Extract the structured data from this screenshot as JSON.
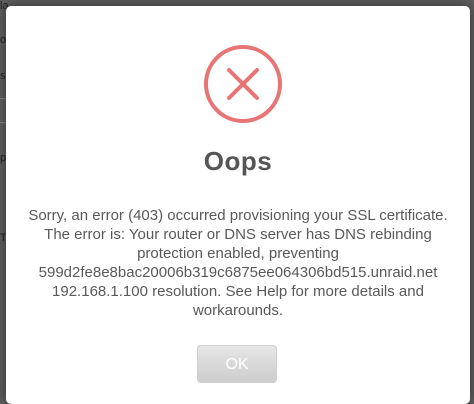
{
  "background": {
    "fragments": [
      "la",
      "o",
      "s",
      "p",
      "T"
    ]
  },
  "dialog": {
    "icon": "error-x-circle-icon",
    "title": "Oops",
    "message": "Sorry, an error (403) occurred provisioning your SSL certificate. The error is: Your router or DNS server has DNS rebinding protection enabled, preventing 599d2fe8e8bac20006b319c6875ee064306bd515.unraid.net 192.168.1.100 resolution. See Help for more details and workarounds.",
    "ok_label": "OK"
  },
  "colors": {
    "error_accent": "#e87575",
    "title": "#555555",
    "text": "#595959"
  }
}
